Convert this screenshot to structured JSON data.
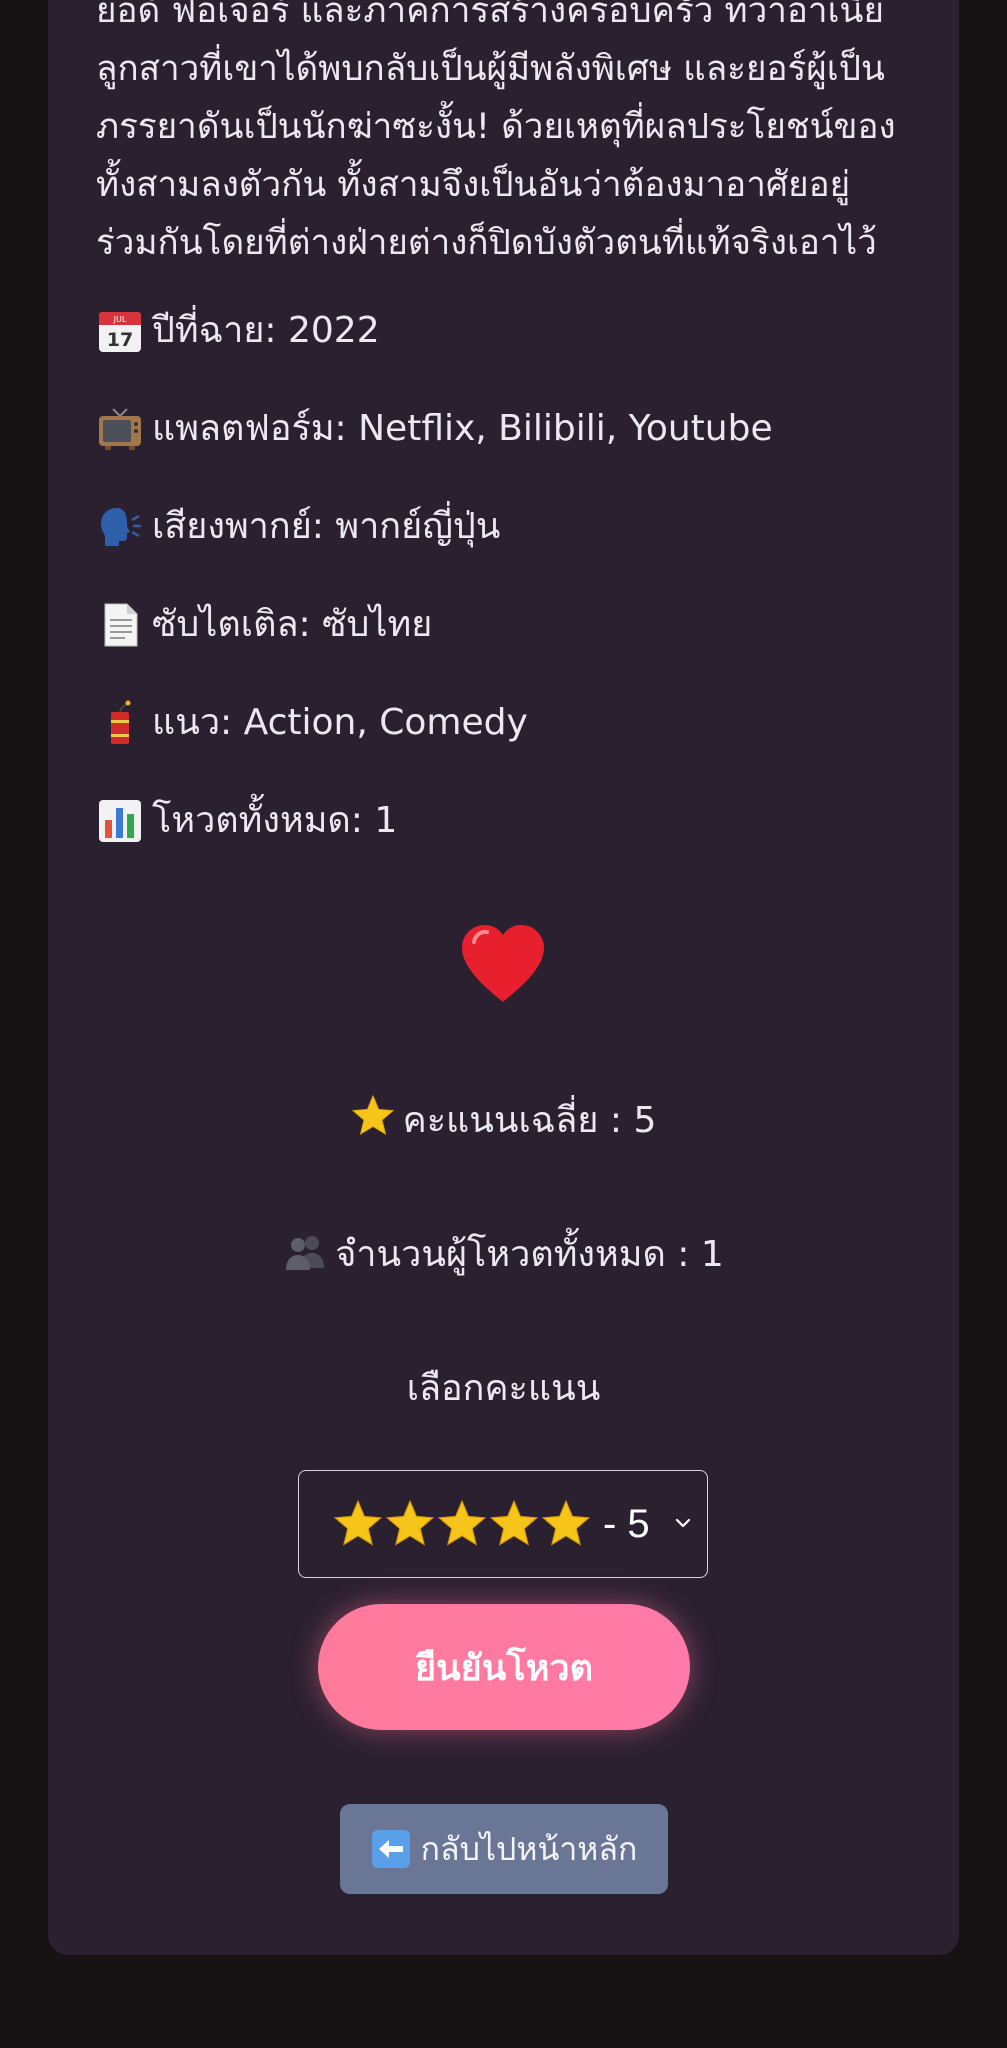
{
  "synopsis": {
    "lines": [
      "ยอด์ ฟอเจอร์ และภาคการสร้างครอบครัว ทว่าอาเนีย",
      "ลูกสาวที่เขาได้พบกลับเป็นผู้มีพลังพิเศษ และยอร์ผู้เป็น",
      "ภรรยาดันเป็นนักฆ่าซะงั้น! ด้วยเหตุที่ผลประโยชน์ของ",
      "ทั้งสามลงตัวกัน ทั้งสามจึงเป็นอันว่าต้องมาอาศัยอยู่",
      "ร่วมกันโดยที่ต่างฝ่ายต่างก็ปิดบังตัวตนที่แท้จริงเอาไว้"
    ]
  },
  "info": {
    "year": "ปีที่ฉาย: 2022",
    "platform": "แพลตฟอร์ม: Netflix, Bilibili, Youtube",
    "dub": "เสียงพากย์: พากย์ญี่ปุ่น",
    "subtitle": "ซับไตเติล: ซับไทย",
    "genre": "แนว: Action, Comedy",
    "votes": "โหวตทั้งหมด: 1"
  },
  "icons": {
    "year": "calendar-icon",
    "platform": "tv-icon",
    "dub": "speaking-head-icon",
    "subtitle": "page-icon",
    "genre": "firecracker-icon",
    "votes": "bar-chart-icon",
    "favorite": "heart-icon",
    "average": "star-icon",
    "voters": "people-icon",
    "back": "left-arrow-icon"
  },
  "rating": {
    "average_text": "คะแนนเฉลี่ย : 5",
    "voters_text": "จำนวนผู้โหวตทั้งหมด : 1",
    "choose_label": "เลือกคะแนน",
    "selected_stars": 5,
    "selected_text": "- 5"
  },
  "actions": {
    "confirm_vote": "ยืนยันโหวต",
    "back_home": "กลับไปหน้าหลัก"
  },
  "colors": {
    "card_bg": "#2a2030",
    "page_bg": "#171214",
    "vote_button": "#ff7aa0",
    "back_button": "#6a7696",
    "star": "#f7c41a",
    "heart": "#e8202e"
  }
}
